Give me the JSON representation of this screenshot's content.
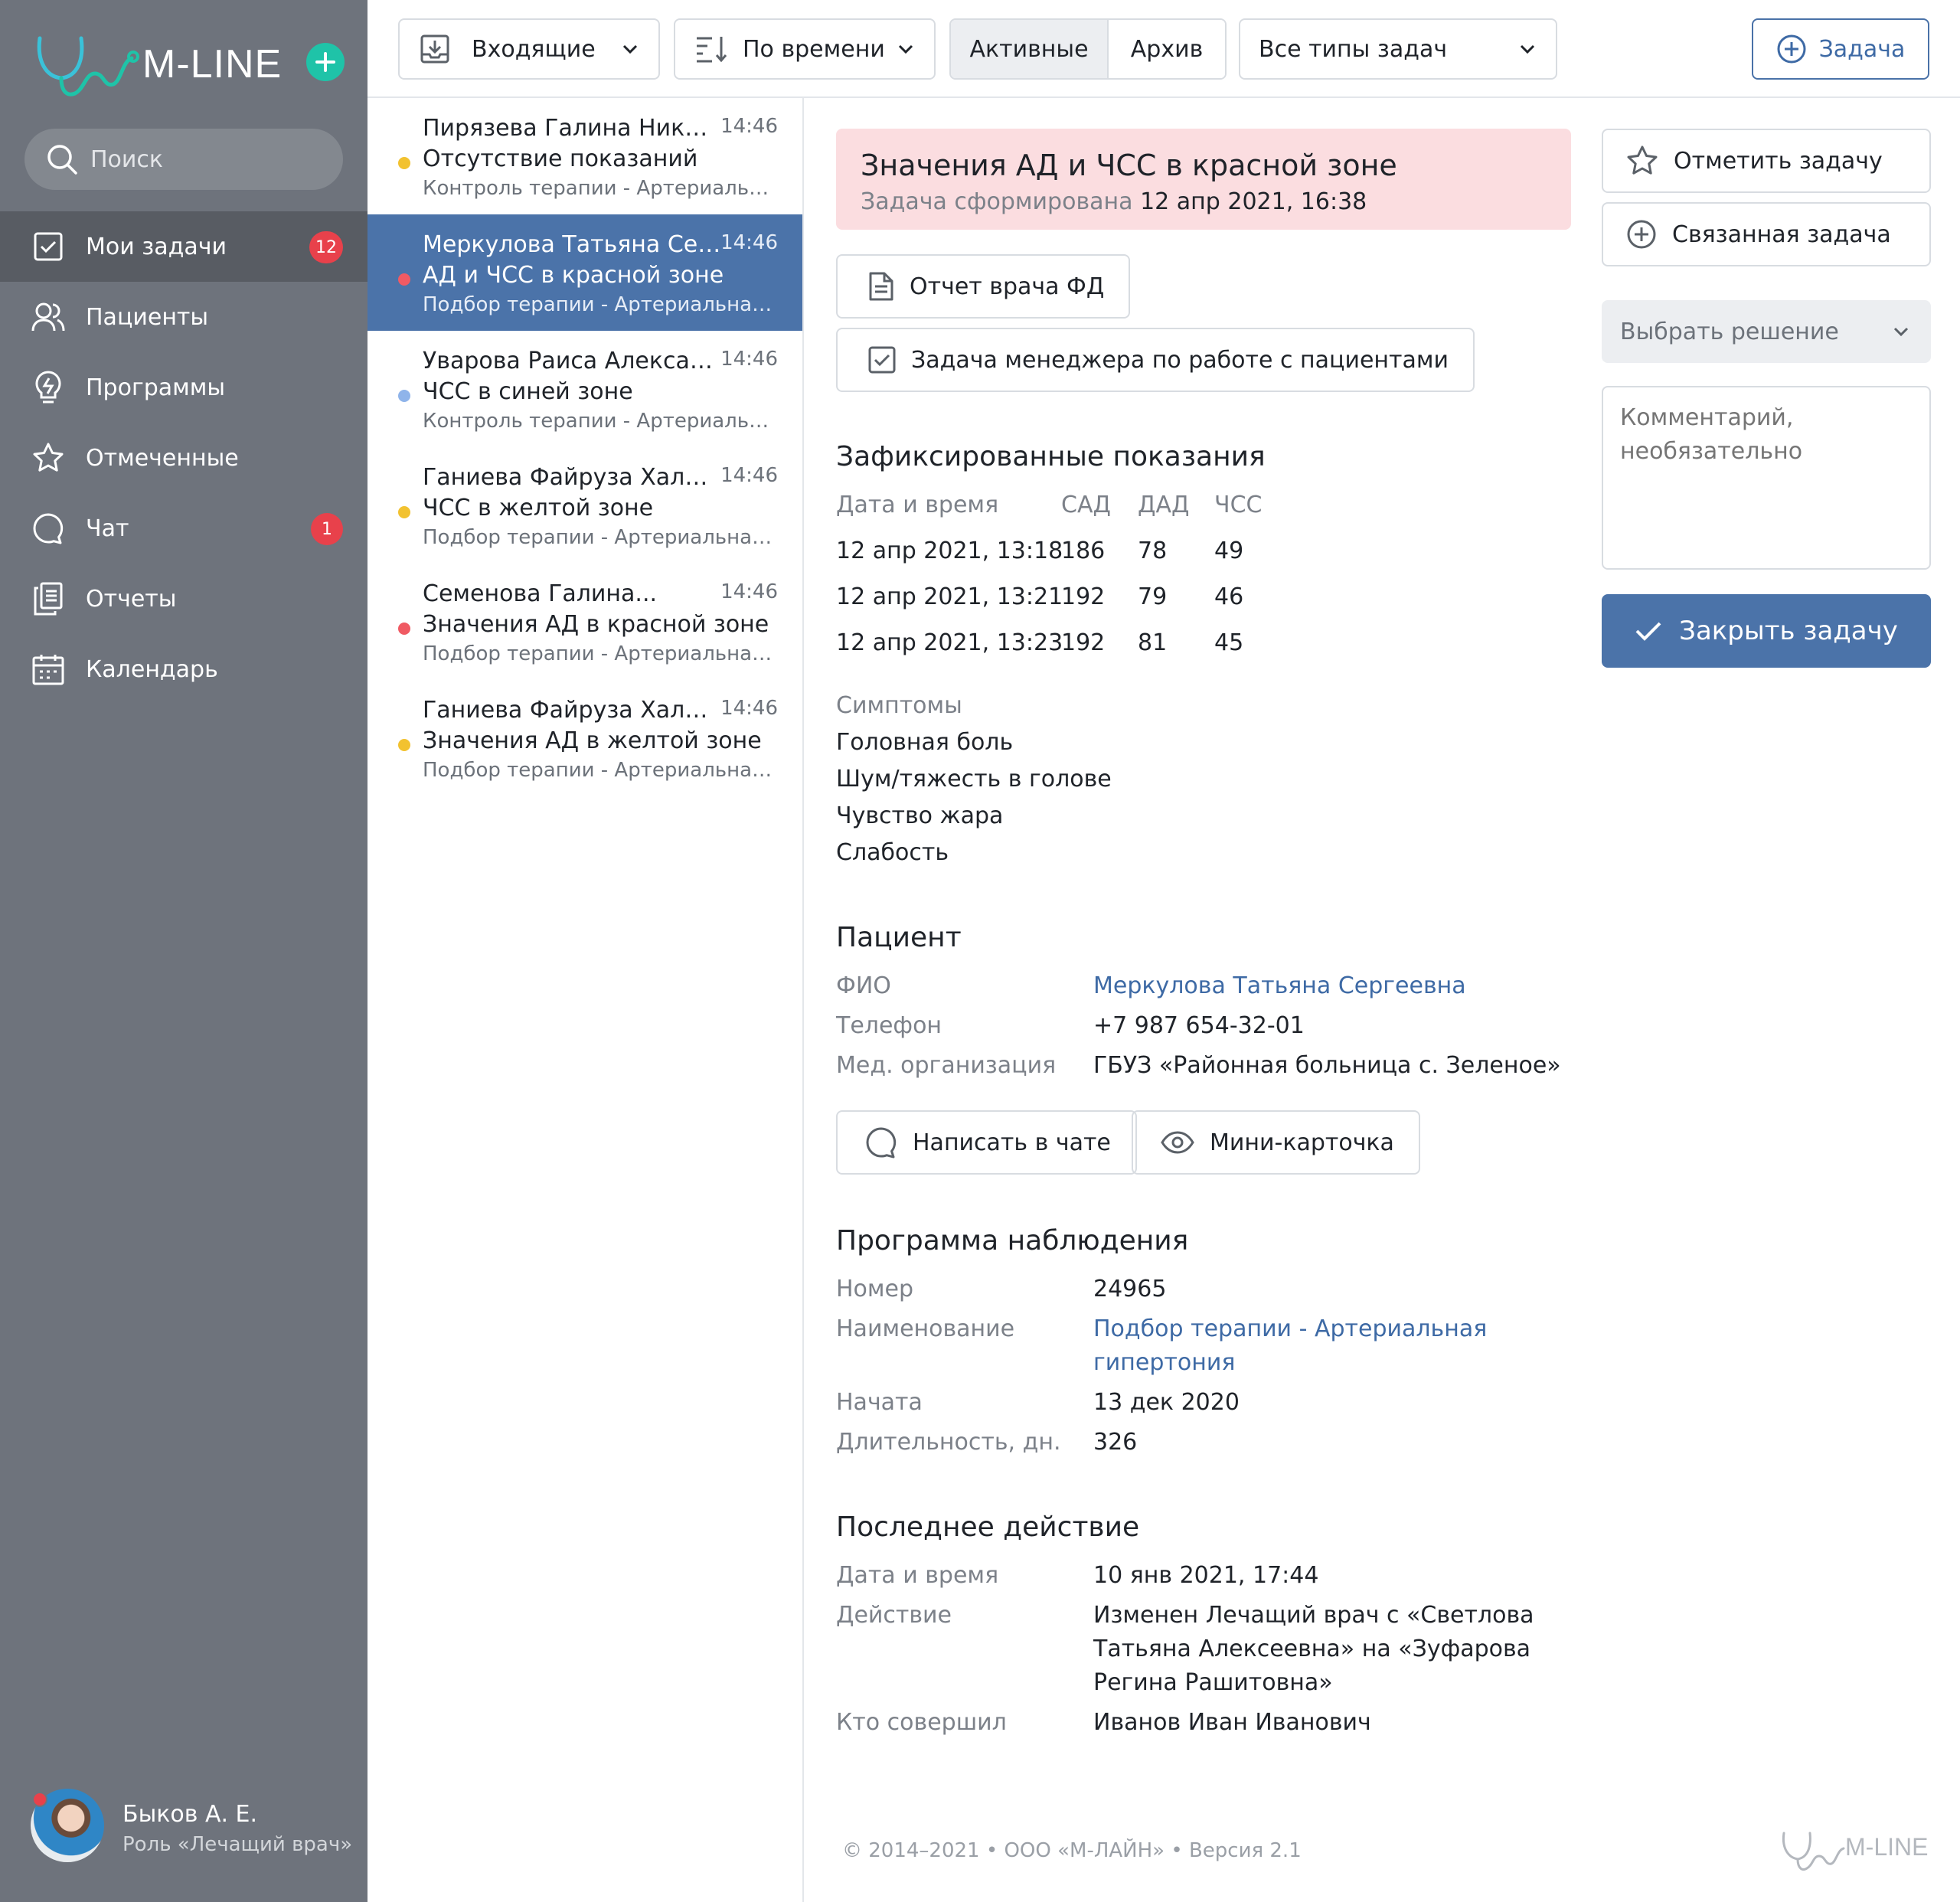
{
  "brand": {
    "name": "M-LINE",
    "accent": "#1fc3a8"
  },
  "search": {
    "placeholder": "Поиск"
  },
  "nav": [
    {
      "label": "Мои задачи",
      "icon": "checkbox-icon",
      "badge": "12",
      "active": true
    },
    {
      "label": "Пациенты",
      "icon": "users-icon"
    },
    {
      "label": "Программы",
      "icon": "lightbulb-icon"
    },
    {
      "label": "Отмеченные",
      "icon": "star-icon"
    },
    {
      "label": "Чат",
      "icon": "chat-icon",
      "badge": "1"
    },
    {
      "label": "Отчеты",
      "icon": "documents-icon"
    },
    {
      "label": "Календарь",
      "icon": "calendar-icon"
    }
  ],
  "user": {
    "name": "Быков А. Е.",
    "role": "Роль «Лечащий врач»"
  },
  "toolbar": {
    "inbox": "Входящие",
    "sort": "По времени",
    "active": "Активные",
    "archive": "Архив",
    "types": "Все типы задач",
    "new_task": "Задача"
  },
  "tasks": [
    {
      "name": "Пирязева Галина Никол...",
      "time": "14:46",
      "issue": "Отсутствие показаний",
      "program": "Контроль терапии - Артериальна...",
      "dot": "#f2c230"
    },
    {
      "name": "Меркулова Татьяна Серг...",
      "time": "14:46",
      "issue": "АД и ЧСС в красной зоне",
      "program": "Подбор терапии - Артериальная г...",
      "dot": "#f05a63",
      "selected": true
    },
    {
      "name": "Уварова Раиса Александ...",
      "time": "14:46",
      "issue": "ЧСС в синей зоне",
      "program": "Контроль терапии - Артериальна...",
      "dot": "#8fb4ea"
    },
    {
      "name": "Ганиева Файруза Халим...",
      "time": "14:46",
      "issue": "ЧСС в желтой зоне",
      "program": "Подбор терапии - Артериальная г...",
      "dot": "#f2c230"
    },
    {
      "name": "Семенова Галина...",
      "time": "14:46",
      "issue": "Значения АД в красной зоне",
      "program": "Подбор терапии - Артериальная г...",
      "dot": "#f05a63"
    },
    {
      "name": "Ганиева Файруза Халим...",
      "time": "14:46",
      "issue": "Значения АД в желтой зоне",
      "program": "Подбор терапии - Артериальная г...",
      "dot": "#f2c230"
    }
  ],
  "alert": {
    "title": "Значения АД и ЧСС в красной зоне",
    "sub_label": "Задача сформирована",
    "sub_value": "12 апр 2021, 16:38"
  },
  "attachments": {
    "report": "Отчет врача ФД",
    "manager_task": "Задача менеджера по работе с пациентами"
  },
  "readings": {
    "title": "Зафиксированные показания",
    "headers": [
      "Дата и время",
      "САД",
      "ДАД",
      "ЧСС"
    ],
    "rows": [
      [
        "12 апр 2021, 13:18",
        "186",
        "78",
        "49"
      ],
      [
        "12 апр 2021, 13:21",
        "192",
        "79",
        "46"
      ],
      [
        "12 апр 2021, 13:23",
        "192",
        "81",
        "45"
      ]
    ],
    "symptoms_label": "Симптомы",
    "symptoms": [
      "Головная боль",
      "Шум/тяжесть в голове",
      "Чувство жара",
      "Слабость"
    ]
  },
  "patient": {
    "title": "Пациент",
    "fio_label": "ФИО",
    "fio": "Меркулова Татьяна Сергеевна",
    "phone_label": "Телефон",
    "phone": "+7 987 654-32-01",
    "org_label": "Мед. организация",
    "org": "ГБУЗ «Районная больница с. Зеленое»",
    "chat_btn": "Написать в чате",
    "card_btn": "Мини-карточка"
  },
  "program": {
    "title": "Программа наблюдения",
    "number_label": "Номер",
    "number": "24965",
    "name_label": "Наименование",
    "name_line1": "Подбор терапии - Артериальная",
    "name_line2": "гипертония",
    "start_label": "Начата",
    "start": "13 дек 2020",
    "duration_label": "Длительность, дн.",
    "duration": "326"
  },
  "last_action": {
    "title": "Последнее действие",
    "date_label": "Дата и время",
    "date": "10 янв 2021, 17:44",
    "action_label": "Действие",
    "action_line1": "Изменен Лечащий врач с «Светлова",
    "action_line2": "Татьяна Алексеевна» на «Зуфарова",
    "action_line3": "Регина Рашитовна»",
    "who_label": "Кто совершил",
    "who": "Иванов Иван Иванович"
  },
  "actions": {
    "mark": "Отметить задачу",
    "related": "Связанная задача",
    "decision_placeholder": "Выбрать решение",
    "comment_placeholder": "Комментарий, необязательно",
    "close": "Закрыть задачу"
  },
  "footer": {
    "text": "© 2014–2021 • ООО «М-ЛАЙН» • Версия 2.1",
    "logo": "M-LINE"
  }
}
